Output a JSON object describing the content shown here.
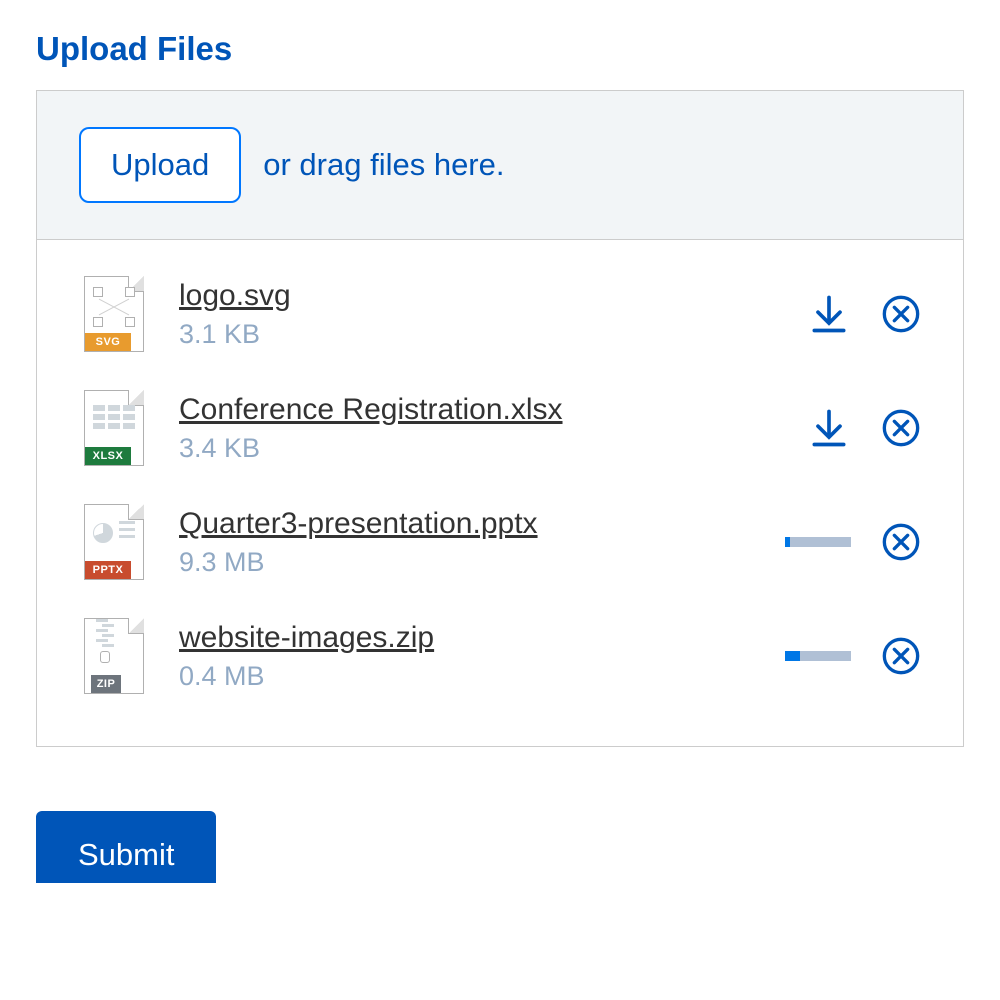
{
  "header": {
    "title": "Upload Files"
  },
  "dropzone": {
    "button_label": "Upload",
    "text": "or drag files here."
  },
  "files": [
    {
      "name": "logo.svg",
      "size": "3.1 KB",
      "type": "svg",
      "status": "done",
      "progress": 100
    },
    {
      "name": "Conference Registration.xlsx",
      "size": "3.4 KB",
      "type": "xlsx",
      "status": "done",
      "progress": 100
    },
    {
      "name": "Quarter3-presentation.pptx",
      "size": "9.3 MB",
      "type": "pptx",
      "status": "uploading",
      "progress": 8
    },
    {
      "name": "website-images.zip",
      "size": "0.4 MB",
      "type": "zip",
      "status": "uploading",
      "progress": 22
    }
  ],
  "submit": {
    "label": "Submit"
  },
  "colors": {
    "primary": "#0055b8"
  }
}
